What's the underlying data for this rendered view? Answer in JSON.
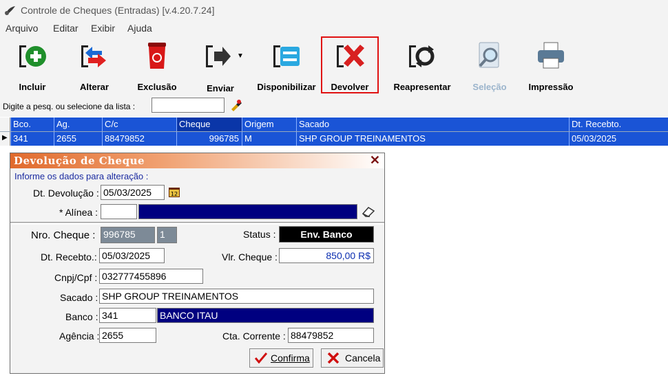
{
  "window": {
    "title": "Controle de Cheques (Entradas) [v.4.20.7.24]"
  },
  "menu": [
    "Arquivo",
    "Editar",
    "Exibir",
    "Ajuda"
  ],
  "toolbar": {
    "incluir": "Incluir",
    "alterar": "Alterar",
    "exclusao": "Exclusão",
    "enviar": "Enviar",
    "disponibilizar": "Disponibilizar",
    "devolver": "Devolver",
    "reapresentar": "Reapresentar",
    "selecao": "Seleção",
    "impressao": "Impressão"
  },
  "search": {
    "label": "Digite a pesq. ou selecione da lista :",
    "value": ""
  },
  "grid": {
    "headers": {
      "bco": "Bco.",
      "ag": "Ag.",
      "cc": "C/c",
      "cheque": "Cheque",
      "origem": "Origem",
      "sacado": "Sacado",
      "dt": "Dt. Recebto."
    },
    "row": {
      "bco": "341",
      "ag": "2655",
      "cc": "88479852",
      "cheque": "996785",
      "origem": "M",
      "sacado": "SHP GROUP TREINAMENTOS",
      "dt": "05/03/2025"
    }
  },
  "dialog": {
    "title": "Devolução de Cheque",
    "instruction": "Informe os dados para alteração :",
    "dt_devolucao_label": "Dt. Devolução :",
    "dt_devolucao_value": "05/03/2025",
    "alinea_label": "* Alínea :",
    "alinea_code": "",
    "alinea_desc": "",
    "nro_cheque_label": "Nro. Cheque :",
    "nro_cheque_value": "996785",
    "nro_cheque_seq": "1",
    "status_label": "Status :",
    "status_value": "Env. Banco",
    "dt_recebto_label": "Dt. Recebto.:",
    "dt_recebto_value": "05/03/2025",
    "vlr_cheque_label": "Vlr. Cheque :",
    "vlr_cheque_value": "850,00 R$",
    "cnpj_label": "Cnpj/Cpf :",
    "cnpj_value": "032777455896",
    "sacado_label": "Sacado :",
    "sacado_value": "SHP GROUP TREINAMENTOS",
    "banco_label": "Banco :",
    "banco_code": "341",
    "banco_name": "BANCO ITAU",
    "agencia_label": "Agência :",
    "agencia_value": "2655",
    "cta_label": "Cta. Corrente :",
    "cta_value": "88479852",
    "confirma_label": "Confirma",
    "cancela_label": "Cancela"
  },
  "colors": {
    "grid_blue": "#1a54d6",
    "navy": "#000080",
    "highlight": "#e01010"
  }
}
